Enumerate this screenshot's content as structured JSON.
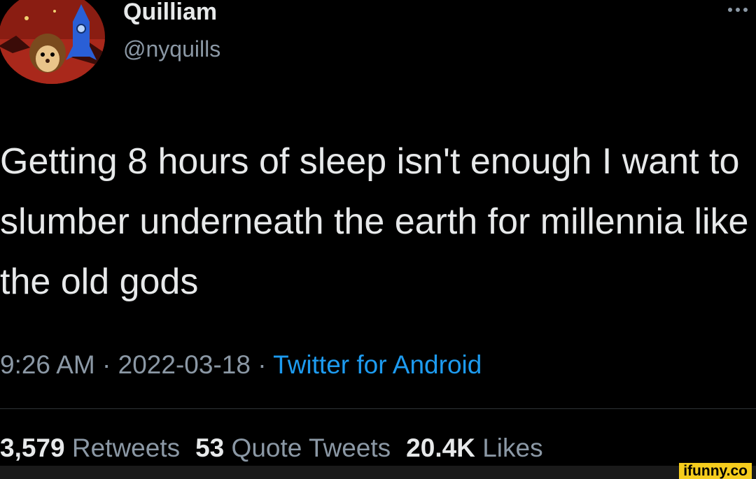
{
  "author": {
    "display_name": "Quilliam",
    "handle": "@nyquills",
    "avatar_icon": "hedgehog-rocket-avatar"
  },
  "more_icon": "more-dots-icon",
  "tweet": {
    "text": "Getting 8 hours of sleep isn't enough I want to slumber underneath the earth for millennia like the old gods",
    "time": "9:26 AM",
    "separator": " · ",
    "date": "2022-03-18",
    "source": "Twitter for Android"
  },
  "stats": {
    "retweets_count": "3,579",
    "retweets_label": "Retweets",
    "quotes_count": "53",
    "quotes_label": "Quote Tweets",
    "likes_count": "20.4K",
    "likes_label": "Likes"
  },
  "watermark": "ifunny.co",
  "colors": {
    "background": "#000000",
    "text": "#e7e9ea",
    "secondary": "#8b98a5",
    "link": "#1d9bf0"
  }
}
